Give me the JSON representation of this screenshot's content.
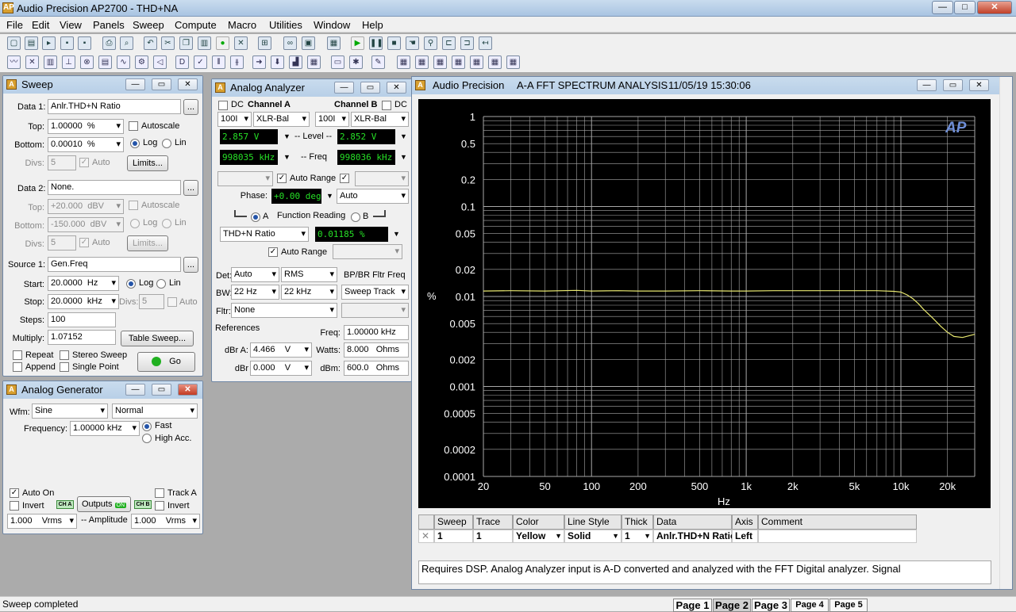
{
  "app": {
    "title": "Audio Precision AP2700 - THD+NA",
    "icon_label": "AP",
    "window_buttons": {
      "minimize": "—",
      "maximize": "□",
      "close": "✕"
    }
  },
  "menu": [
    "File",
    "Edit",
    "View",
    "Panels",
    "Sweep",
    "Compute",
    "Macro",
    "Utilities",
    "Window",
    "Help"
  ],
  "sweep_panel": {
    "title": "Sweep",
    "data1": {
      "label": "Data 1:",
      "value": "Anlr.THD+N Ratio",
      "browse": "...",
      "top_label": "Top:",
      "top": "1.00000",
      "top_unit": "%",
      "bottom_label": "Bottom:",
      "bottom": "0.00010",
      "bottom_unit": "%",
      "autoscale": "Autoscale",
      "log": "Log",
      "lin": "Lin",
      "divs_label": "Divs:",
      "divs": "5",
      "auto": "Auto",
      "limits": "Limits..."
    },
    "data2": {
      "label": "Data 2:",
      "value": "None.",
      "browse": "...",
      "top_label": "Top:",
      "top": "+20.000",
      "top_unit": "dBV",
      "bottom_label": "Bottom:",
      "bottom": "-150.000",
      "bottom_unit": "dBV",
      "autoscale": "Autoscale",
      "log": "Log",
      "lin": "Lin",
      "divs_label": "Divs:",
      "divs": "5",
      "auto": "Auto",
      "limits": "Limits..."
    },
    "source1": {
      "label": "Source 1:",
      "value": "Gen.Freq",
      "browse": "...",
      "start_label": "Start:",
      "start": "20.0000",
      "start_unit": "Hz",
      "log": "Log",
      "lin": "Lin",
      "stop_label": "Stop:",
      "stop": "20.0000",
      "stop_unit": "kHz",
      "divs_label": "Divs:",
      "divs": "5",
      "auto": "Auto",
      "steps_label": "Steps:",
      "steps": "100",
      "multiply_label": "Multiply:",
      "multiply": "1.07152",
      "table_sweep": "Table Sweep..."
    },
    "repeat": "Repeat",
    "append": "Append",
    "stereo_sweep": "Stereo Sweep",
    "single_point": "Single Point",
    "go": "Go"
  },
  "generator_panel": {
    "title": "Analog Generator",
    "wfm_label": "Wfm:",
    "wfm": "Sine",
    "wfm_mode": "Normal",
    "freq_label": "Frequency:",
    "freq": "1.00000 kHz",
    "fast": "Fast",
    "high_acc": "High Acc.",
    "auto_on": "Auto On",
    "invert": "Invert",
    "track_a": "Track A",
    "invert_b": "Invert",
    "cha": "CH A",
    "chb": "CH B",
    "outputs": "Outputs",
    "outputs_on": "ON",
    "amp_a": "1.000",
    "amp_unit_a": "Vrms",
    "amp_label": "-- Amplitude",
    "amp_b": "1.000",
    "amp_unit_b": "Vrms"
  },
  "analyzer_panel": {
    "title": "Analog Analyzer",
    "dc_a": "DC",
    "channel_a": "Channel A",
    "channel_b": "Channel B",
    "dc_b": "DC",
    "range_a": "100I",
    "input_a": "XLR-Bal",
    "range_b": "100I",
    "input_b": "XLR-Bal",
    "level_a": "2.857   V",
    "level_label": "-- Level --",
    "level_b": "2.852   V",
    "freq_a": "998035 kHz",
    "freq_label": "-- Freq",
    "freq_b": "998036 kHz",
    "auto_range": "Auto Range",
    "phase_label": "Phase:",
    "phase": "+0.00   deg",
    "phase_mode": "Auto",
    "radio_a": "A",
    "function_reading": "Function Reading",
    "radio_b": "B",
    "function": "THD+N Ratio",
    "function_value": "0.01185  %",
    "auto_range2": "Auto Range",
    "det_label": "Det:",
    "det": "Auto",
    "det_type": "RMS",
    "bp_label": "BP/BR Fltr Freq",
    "bw_label": "BW:",
    "bw_low": "22 Hz",
    "bw_high": "22 kHz",
    "bp_mode": "Sweep Track",
    "fltr_label": "Fltr:",
    "fltr": "None",
    "references": "References",
    "ref_freq_label": "Freq:",
    "ref_freq": "1.00000 kHz",
    "dbra_label": "dBr A:",
    "dbra": "4.466",
    "dbra_unit": "V",
    "watts_label": "Watts:",
    "watts": "8.000",
    "watts_unit": "Ohms",
    "dbr_label": "dBr",
    "dbr": "0.000",
    "dbr_unit": "V",
    "dbm_label": "dBm:",
    "dbm": "600.0",
    "dbm_unit": "Ohms"
  },
  "graph_window": {
    "title_prefix": "Audio Precision",
    "title": "A-A FFT SPECTRUM ANALYSIS",
    "timestamp": "11/05/19 15:30:06",
    "logo": "AP",
    "table_headers": [
      "Sweep",
      "Trace",
      "Color",
      "Line Style",
      "Thick",
      "Data",
      "Axis",
      "Comment"
    ],
    "table_row": {
      "sweep": "1",
      "trace": "1",
      "color": "Yellow",
      "line_style": "Solid",
      "thick": "1",
      "data": "Anlr.THD+N Ratio",
      "axis": "Left",
      "comment": ""
    },
    "comment_text": "Requires DSP.  Analog Analyzer input is A-D converted and analyzed with the FFT Digital analyzer.  Signal"
  },
  "chart_data": {
    "type": "line",
    "xlabel": "Hz",
    "ylabel": "%",
    "x_scale": "log",
    "y_scale": "log",
    "xlim": [
      20,
      30000
    ],
    "ylim": [
      0.0001,
      1
    ],
    "x_ticks": [
      20,
      50,
      100,
      200,
      500,
      1000,
      2000,
      5000,
      10000,
      20000
    ],
    "x_tick_labels": [
      "20",
      "50",
      "100",
      "200",
      "500",
      "1k",
      "2k",
      "5k",
      "10k",
      "20k"
    ],
    "y_ticks": [
      1,
      0.5,
      0.2,
      0.1,
      0.05,
      0.02,
      0.01,
      0.005,
      0.002,
      0.001,
      0.0005,
      0.0002,
      0.0001
    ],
    "y_tick_labels": [
      "1",
      "0.5",
      "0.2",
      "0.1",
      "0.05",
      "0.02",
      "0.01",
      "0.005",
      "0.002",
      "0.001",
      "0.0005",
      "0.0002",
      "0.0001"
    ],
    "grid": true,
    "background": "#000000",
    "grid_color": "#a8a8a8",
    "series": [
      {
        "color": "#e8e870",
        "x": [
          20,
          30,
          50,
          80,
          100,
          150,
          200,
          300,
          500,
          800,
          1000,
          1500,
          2000,
          3000,
          5000,
          7000,
          9000,
          10000,
          11000,
          12000,
          13000,
          14000,
          16000,
          18000,
          20000,
          22000,
          25000,
          30000
        ],
        "y": [
          0.0115,
          0.0116,
          0.0115,
          0.0117,
          0.0115,
          0.0116,
          0.0115,
          0.0115,
          0.0116,
          0.0115,
          0.0115,
          0.0116,
          0.0116,
          0.0116,
          0.0116,
          0.0116,
          0.0114,
          0.0112,
          0.0104,
          0.0094,
          0.0083,
          0.0072,
          0.0058,
          0.0047,
          0.004,
          0.0036,
          0.0035,
          0.0038
        ]
      }
    ]
  },
  "status": {
    "text": "Sweep completed",
    "pages": [
      "Page 1",
      "Page 2",
      "Page 3",
      "Page 4",
      "Page 5"
    ]
  }
}
